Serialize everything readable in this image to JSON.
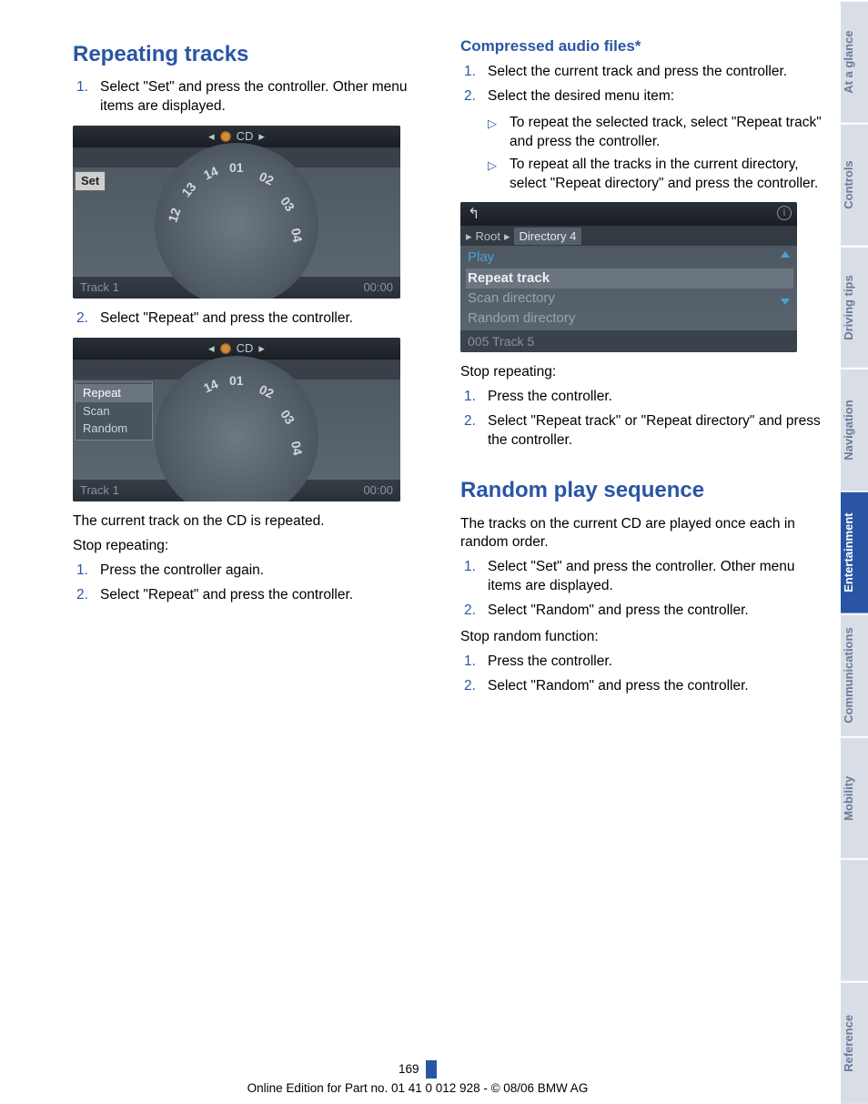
{
  "left": {
    "heading": "Repeating tracks",
    "step1_num": "1.",
    "step1": "Select \"Set\" and press the controller. Other menu items are displayed.",
    "step2_num": "2.",
    "step2": "Select \"Repeat\" and press the controller.",
    "after1": "The current track on the CD is repeated.",
    "after2": "Stop repeating:",
    "sr1_num": "1.",
    "sr1": "Press the controller again.",
    "sr2_num": "2.",
    "sr2": "Select \"Repeat\" and press the controller."
  },
  "scr1": {
    "top": "CD",
    "sub": "CD",
    "set": "Set",
    "track": "Track 1",
    "time": "00:00",
    "d01": "01",
    "d02": "02",
    "d03": "03",
    "d04": "04",
    "d12": "12",
    "d13": "13",
    "d14": "14"
  },
  "scr2": {
    "top": "CD",
    "sub": "CD",
    "m1": "Repeat",
    "m2": "Scan",
    "m3": "Random",
    "track": "Track 1",
    "time": "00:00",
    "d01": "01",
    "d02": "02",
    "d03": "03",
    "d04": "04",
    "d14": "14"
  },
  "right": {
    "sub1": "Compressed audio files*",
    "c1_num": "1.",
    "c1": "Select the current track and press the controller.",
    "c2_num": "2.",
    "c2": "Select the desired menu item:",
    "b1": "To repeat the selected track, select \"Repeat track\" and press the controller.",
    "b2": "To repeat all the tracks in the current directory, select \"Repeat directory\" and press the controller.",
    "stoprep": "Stop repeating:",
    "s1_num": "1.",
    "s1": "Press the controller.",
    "s2_num": "2.",
    "s2": "Select \"Repeat track\" or \"Repeat directory\" and press the controller.",
    "heading2": "Random play sequence",
    "r_intro": "The tracks on the current CD are played once each in random order.",
    "r1_num": "1.",
    "r1": "Select \"Set\" and press the controller. Other menu items are displayed.",
    "r2_num": "2.",
    "r2": "Select \"Random\" and press the controller.",
    "stoprand": "Stop random function:",
    "sr1_num": "1.",
    "sr1": "Press the controller.",
    "sr2_num": "2.",
    "sr2": "Select \"Random\" and press the controller."
  },
  "scr3": {
    "crumb_arrow": "▸",
    "root": "Root",
    "dir": "Directory 4",
    "row1": "Play",
    "row2": "Repeat track",
    "row3": "Scan directory",
    "row4": "Random directory",
    "foot": "005 Track 5",
    "back": "↰",
    "info": "i"
  },
  "tabs": {
    "t1": "At a glance",
    "t2": "Controls",
    "t3": "Driving tips",
    "t4": "Navigation",
    "t5": "Entertainment",
    "t6": "Communications",
    "t7": "Mobility",
    "t8": "Reference"
  },
  "footer": {
    "page": "169",
    "line": "Online Edition for Part no. 01 41 0 012 928 - © 08/06 BMW AG"
  },
  "glyph": {
    "tri": "▷",
    "left": "◂",
    "right": "▸"
  }
}
